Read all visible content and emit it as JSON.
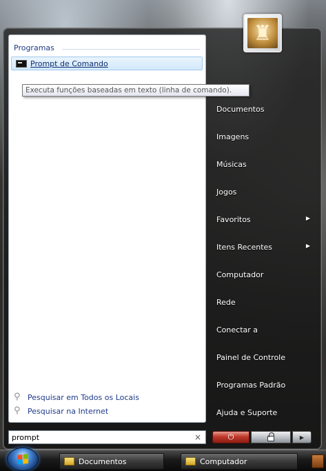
{
  "start_menu": {
    "programs_header": "Programas",
    "search_results": [
      {
        "label": "Prompt de Comando",
        "icon": "cmd-icon"
      }
    ],
    "tooltip": "Executa funções baseadas em texto (linha de comando).",
    "bottom_links": [
      {
        "label": "Pesquisar em Todos os Locais",
        "icon": "search-icon"
      },
      {
        "label": "Pesquisar na Internet",
        "icon": "search-icon"
      }
    ],
    "search_box": {
      "value": "prompt",
      "clear_icon": "×"
    },
    "right_items": [
      {
        "label": "Documentos",
        "has_arrow": false
      },
      {
        "label": "Imagens",
        "has_arrow": false
      },
      {
        "label": "Músicas",
        "has_arrow": false
      },
      {
        "label": "Jogos",
        "has_arrow": false
      },
      {
        "label": "Favoritos",
        "has_arrow": true
      },
      {
        "label": "Itens Recentes",
        "has_arrow": true
      },
      {
        "label": "Computador",
        "has_arrow": false
      },
      {
        "label": "Rede",
        "has_arrow": false
      },
      {
        "label": "Conectar a",
        "has_arrow": false
      },
      {
        "label": "Painel de Controle",
        "has_arrow": false
      },
      {
        "label": "Programas Padrão",
        "has_arrow": false
      },
      {
        "label": "Ajuda e Suporte",
        "has_arrow": false
      }
    ],
    "power_buttons": {
      "power_icon": "power-icon",
      "lock_icon": "lock-icon",
      "more_icon": "arrow-right-icon"
    },
    "avatar_icon": "chess-pieces-icon"
  },
  "taskbar": {
    "start_icon": "windows-orb-icon",
    "items": [
      {
        "label": "Documentos",
        "icon": "folder-icon"
      },
      {
        "label": "Computador",
        "icon": "folder-icon"
      }
    ]
  },
  "colors": {
    "accent_text": "#1e3a8a",
    "highlight_bg": "#d3e8fb",
    "power_red": "#c0392b"
  }
}
